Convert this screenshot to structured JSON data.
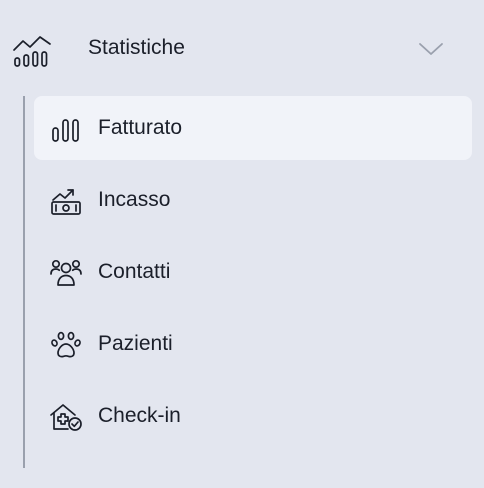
{
  "section": {
    "title": "Statistiche",
    "icon": "statistics-chart-icon",
    "expanded": true
  },
  "items": [
    {
      "label": "Fatturato",
      "icon": "bar-chart-icon",
      "active": true
    },
    {
      "label": "Incasso",
      "icon": "cash-growth-icon",
      "active": false
    },
    {
      "label": "Contatti",
      "icon": "people-group-icon",
      "active": false
    },
    {
      "label": "Pazienti",
      "icon": "paw-icon",
      "active": false
    },
    {
      "label": "Check-in",
      "icon": "clinic-check-icon",
      "active": false
    }
  ],
  "colors": {
    "background": "#e3e6ef",
    "active_item_background": "#f1f3f9",
    "text": "#1b1f2a",
    "tree_line": "#9aa0ad",
    "chevron": "#9aa0ad"
  }
}
